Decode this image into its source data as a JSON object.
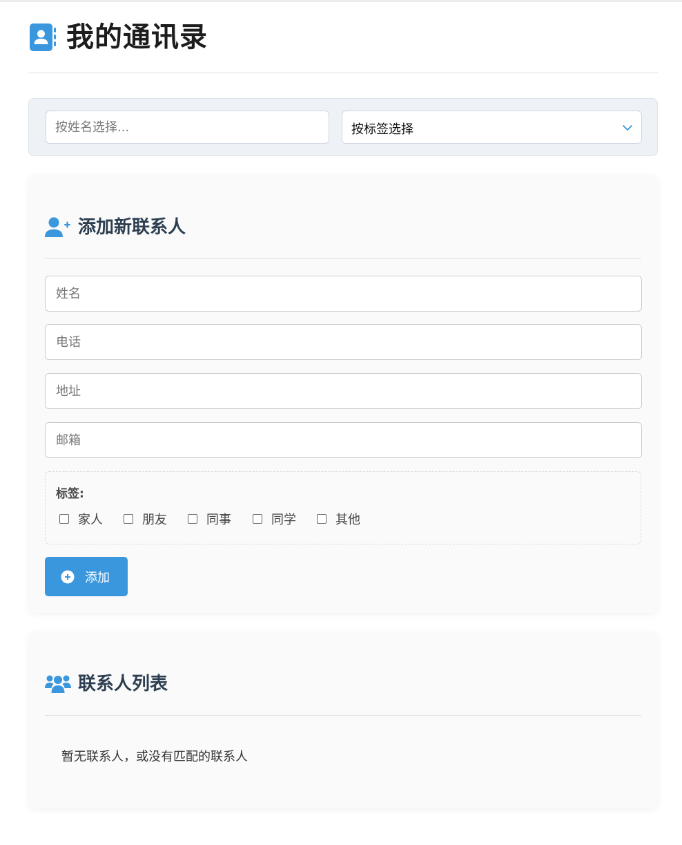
{
  "header": {
    "title": "我的通讯录",
    "icon": "address-book-icon"
  },
  "filter": {
    "search_placeholder": "按姓名选择...",
    "tag_select_value": "按标签选择"
  },
  "add_contact": {
    "heading": "添加新联系人",
    "heading_icon": "user-plus-icon",
    "fields": {
      "name_placeholder": "姓名",
      "phone_placeholder": "电话",
      "address_placeholder": "地址",
      "email_placeholder": "邮箱"
    },
    "tags_label": "标签:",
    "tags": [
      {
        "label": "家人",
        "checked": false
      },
      {
        "label": "朋友",
        "checked": false
      },
      {
        "label": "同事",
        "checked": false
      },
      {
        "label": "同学",
        "checked": false
      },
      {
        "label": "其他",
        "checked": false
      }
    ],
    "submit_label": "添加",
    "submit_icon": "plus-circle-icon"
  },
  "contact_list": {
    "heading": "联系人列表",
    "heading_icon": "users-icon",
    "empty_message": "暂无联系人，或没有匹配的联系人"
  },
  "colors": {
    "accent": "#3a97dd",
    "heading": "#2c3e50",
    "filter_bg": "#eef2f7"
  }
}
